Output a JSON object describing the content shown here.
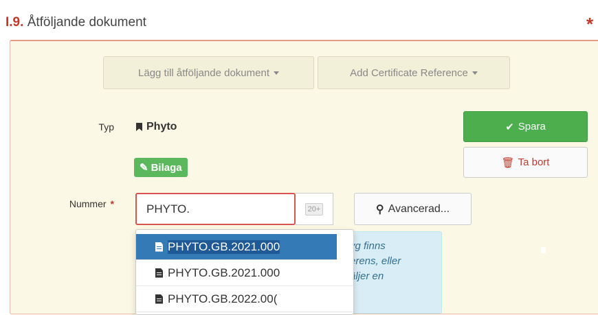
{
  "section": {
    "number": "I.9.",
    "title": "Åtföljande dokument",
    "required_mark": "*"
  },
  "toolbar": {
    "add_document_label": "Lägg till åtföljande dokument",
    "add_certificate_label": "Add Certificate Reference"
  },
  "form": {
    "typ_label": "Typ",
    "typ_value": "Phyto",
    "attachment_label": "Bilaga",
    "nummer_label": "Nummer",
    "nummer_required": "*",
    "nummer_value": "PHYTO.",
    "result_count": "20+",
    "advanced_label": "Avancerad..."
  },
  "actions": {
    "save_label": "Spara",
    "delete_label": "Ta bort"
  },
  "info_lines": [
    "vg finns",
    "erens, eller",
    "äljer en"
  ],
  "suggestions": [
    "PHYTO.GB.2021.000",
    "PHYTO.GB.2021.000",
    "PHYTO.GB.2022.00("
  ],
  "colors": {
    "required": "#c0392b",
    "success": "#4cae4c",
    "primary": "#337ab7",
    "panel": "#fbf8e5"
  }
}
